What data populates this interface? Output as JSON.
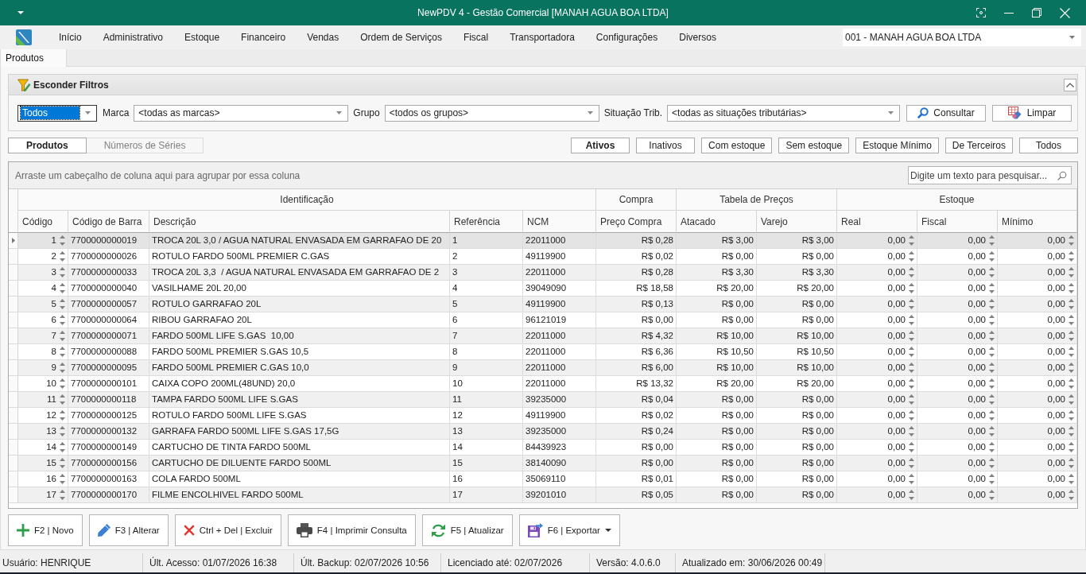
{
  "window": {
    "title": "NewPDV 4 - Gestão Comercial [MANAH AGUA BOA LTDA]"
  },
  "menu": {
    "items": [
      "Início",
      "Administrativo",
      "Estoque",
      "Financeiro",
      "Vendas",
      "Ordem de Serviços",
      "Fiscal",
      "Transportadora",
      "Configurações",
      "Diversos"
    ]
  },
  "company_select": {
    "value": "001 - MANAH AGUA BOA LTDA"
  },
  "document_tabs": [
    {
      "label": "Produtos",
      "selected": true
    }
  ],
  "filters": {
    "title": "Esconder Filtros",
    "expanded": true,
    "status_select": {
      "value": "Todos",
      "focused": true
    },
    "fields": [
      {
        "label": "Marca",
        "value": "<todas as marcas>"
      },
      {
        "label": "Grupo",
        "value": "<todos os grupos>"
      },
      {
        "label": "Situação Trib.",
        "value": "<todas as situações tributárias>"
      }
    ],
    "buttons": [
      {
        "label": "Consultar",
        "kind": "search"
      },
      {
        "label": "Limpar",
        "kind": "clear"
      }
    ]
  },
  "view_tabs": [
    {
      "label": "Produtos",
      "selected": true
    },
    {
      "label": "Números de Séries",
      "selected": false
    }
  ],
  "status_filters": [
    {
      "label": "Ativos",
      "selected": true
    },
    {
      "label": "Inativos",
      "selected": false
    },
    {
      "label": "Com estoque",
      "selected": false
    },
    {
      "label": "Sem estoque",
      "selected": false
    },
    {
      "label": "Estoque Mínimo",
      "selected": false
    },
    {
      "label": "De Terceiros",
      "selected": false
    },
    {
      "label": "Todos",
      "selected": false
    }
  ],
  "grid": {
    "group_panel_hint": "Arraste um cabeçalho de coluna aqui para agrupar por essa coluna",
    "search": {
      "placeholder": "Digite um texto para pesquisar..."
    },
    "bands": [
      {
        "label": "Identificação",
        "columns": [
          {
            "label": "Código",
            "kind": "spin"
          },
          {
            "label": "Código de Barra",
            "kind": "text"
          },
          {
            "label": "Descrição",
            "kind": "text"
          },
          {
            "label": "Referência",
            "kind": "text"
          },
          {
            "label": "NCM",
            "kind": "text"
          }
        ]
      },
      {
        "label": "Compra",
        "columns": [
          {
            "label": "Preço Compra",
            "kind": "money"
          }
        ]
      },
      {
        "label": "Tabela de Preços",
        "columns": [
          {
            "label": "Atacado",
            "kind": "money"
          },
          {
            "label": "Varejo",
            "kind": "money"
          }
        ]
      },
      {
        "label": "Estoque",
        "columns": [
          {
            "label": "Real",
            "kind": "spin"
          },
          {
            "label": "Fiscal",
            "kind": "spin"
          },
          {
            "label": "Mínimo",
            "kind": "spin"
          }
        ]
      }
    ],
    "rows": [
      {
        "selected": true,
        "cells": [
          "1",
          "7700000000019",
          "TROCA 20L 3,0 / AGUA NATURAL ENVASADA EM GARRAFAO DE 20",
          "1",
          "22011000",
          "R$ 0,28",
          "R$ 3,00",
          "R$ 3,00",
          "0,00",
          "0,00",
          "0,00"
        ]
      },
      {
        "selected": false,
        "cells": [
          "2",
          "7700000000026",
          "ROTULO FARDO 500ML PREMIER C.GAS",
          "2",
          "49119900",
          "R$ 0,02",
          "R$ 0,00",
          "R$ 0,00",
          "0,00",
          "0,00",
          "0,00"
        ]
      },
      {
        "selected": false,
        "cells": [
          "3",
          "7700000000033",
          "TROCA 20L 3,3  / AGUA NATURAL ENVASADA EM GARRAFAO DE 2",
          "3",
          "22011000",
          "R$ 0,28",
          "R$ 3,30",
          "R$ 3,30",
          "0,00",
          "0,00",
          "0,00"
        ]
      },
      {
        "selected": false,
        "cells": [
          "4",
          "7700000000040",
          "VASILHAME 20L 20,00",
          "4",
          "39049090",
          "R$ 18,58",
          "R$ 20,00",
          "R$ 20,00",
          "0,00",
          "0,00",
          "0,00"
        ]
      },
      {
        "selected": false,
        "cells": [
          "5",
          "7700000000057",
          "ROTULO GARRAFAO 20L",
          "5",
          "49119900",
          "R$ 0,13",
          "R$ 0,00",
          "R$ 0,00",
          "0,00",
          "0,00",
          "0,00"
        ]
      },
      {
        "selected": false,
        "cells": [
          "6",
          "7700000000064",
          "RIBOU GARRAFAO 20L",
          "6",
          "96121019",
          "R$ 0,00",
          "R$ 0,00",
          "R$ 0,00",
          "0,00",
          "0,00",
          "0,00"
        ]
      },
      {
        "selected": false,
        "cells": [
          "7",
          "7700000000071",
          "FARDO 500ML LIFE S.GAS  10,00",
          "7",
          "22011000",
          "R$ 4,32",
          "R$ 10,00",
          "R$ 10,00",
          "0,00",
          "0,00",
          "0,00"
        ]
      },
      {
        "selected": false,
        "cells": [
          "8",
          "7700000000088",
          "FARDO 500ML PREMIER S.GAS 10,5",
          "8",
          "22011000",
          "R$ 6,36",
          "R$ 10,50",
          "R$ 10,50",
          "0,00",
          "0,00",
          "0,00"
        ]
      },
      {
        "selected": false,
        "cells": [
          "9",
          "7700000000095",
          "FARDO 500ML PREMIER C.GAS 10,0",
          "9",
          "22011000",
          "R$ 6,00",
          "R$ 10,00",
          "R$ 10,00",
          "0,00",
          "0,00",
          "0,00"
        ]
      },
      {
        "selected": false,
        "cells": [
          "10",
          "7700000000101",
          "CAIXA COPO 200ML(48UND) 20,0",
          "10",
          "22011000",
          "R$ 13,32",
          "R$ 20,00",
          "R$ 20,00",
          "0,00",
          "0,00",
          "0,00"
        ]
      },
      {
        "selected": false,
        "cells": [
          "11",
          "7700000000118",
          "TAMPA FARDO 500ML LIFE S.GAS",
          "11",
          "39235000",
          "R$ 0,04",
          "R$ 0,00",
          "R$ 0,00",
          "0,00",
          "0,00",
          "0,00"
        ]
      },
      {
        "selected": false,
        "cells": [
          "12",
          "7700000000125",
          "ROTULO FARDO 500ML LIFE S.GAS",
          "12",
          "49119900",
          "R$ 0,02",
          "R$ 0,00",
          "R$ 0,00",
          "0,00",
          "0,00",
          "0,00"
        ]
      },
      {
        "selected": false,
        "cells": [
          "13",
          "7700000000132",
          "GARRAFA FARDO 500ML LIFE S.GAS 17,5G",
          "13",
          "39235000",
          "R$ 0,24",
          "R$ 0,00",
          "R$ 0,00",
          "0,00",
          "0,00",
          "0,00"
        ]
      },
      {
        "selected": false,
        "cells": [
          "14",
          "7700000000149",
          "CARTUCHO DE TINTA FARDO 500ML",
          "14",
          "84439923",
          "R$ 0,00",
          "R$ 0,00",
          "R$ 0,00",
          "0,00",
          "0,00",
          "0,00"
        ]
      },
      {
        "selected": false,
        "cells": [
          "15",
          "7700000000156",
          "CARTUCHO DE DILUENTE FARDO 500ML",
          "15",
          "38140090",
          "R$ 0,00",
          "R$ 0,00",
          "R$ 0,00",
          "0,00",
          "0,00",
          "0,00"
        ]
      },
      {
        "selected": false,
        "cells": [
          "16",
          "7700000000163",
          "COLA FARDO 500ML",
          "16",
          "35069110",
          "R$ 0,01",
          "R$ 0,00",
          "R$ 0,00",
          "0,00",
          "0,00",
          "0,00"
        ]
      },
      {
        "selected": false,
        "cells": [
          "17",
          "7700000000170",
          "FILME ENCOLHIVEL FARDO 500ML",
          "17",
          "39201010",
          "R$ 0,05",
          "R$ 0,00",
          "R$ 0,00",
          "0,00",
          "0,00",
          "0,00"
        ]
      }
    ]
  },
  "actions": [
    {
      "label": "F2 | Novo",
      "kind": "new",
      "dropdown": false
    },
    {
      "label": "F3 | Alterar",
      "kind": "edit",
      "dropdown": false
    },
    {
      "label": "Ctrl + Del | Excluir",
      "kind": "delete",
      "dropdown": false
    },
    {
      "label": "F4 | Imprimir Consulta",
      "kind": "print",
      "dropdown": false
    },
    {
      "label": "F5 | Atualizar",
      "kind": "refresh",
      "dropdown": false
    },
    {
      "label": "F6 | Exportar",
      "kind": "export",
      "dropdown": true
    }
  ],
  "status_bar": [
    "Usuário: HENRIQUE",
    "Últ. Acesso: 01/07/2026 16:38",
    "Últ. Backup: 02/07/2026 10:56",
    "Licenciado até: 02/07/2026",
    "Versão: 4.0.6.0",
    "Atualizado em: 30/06/2026 00:49"
  ]
}
